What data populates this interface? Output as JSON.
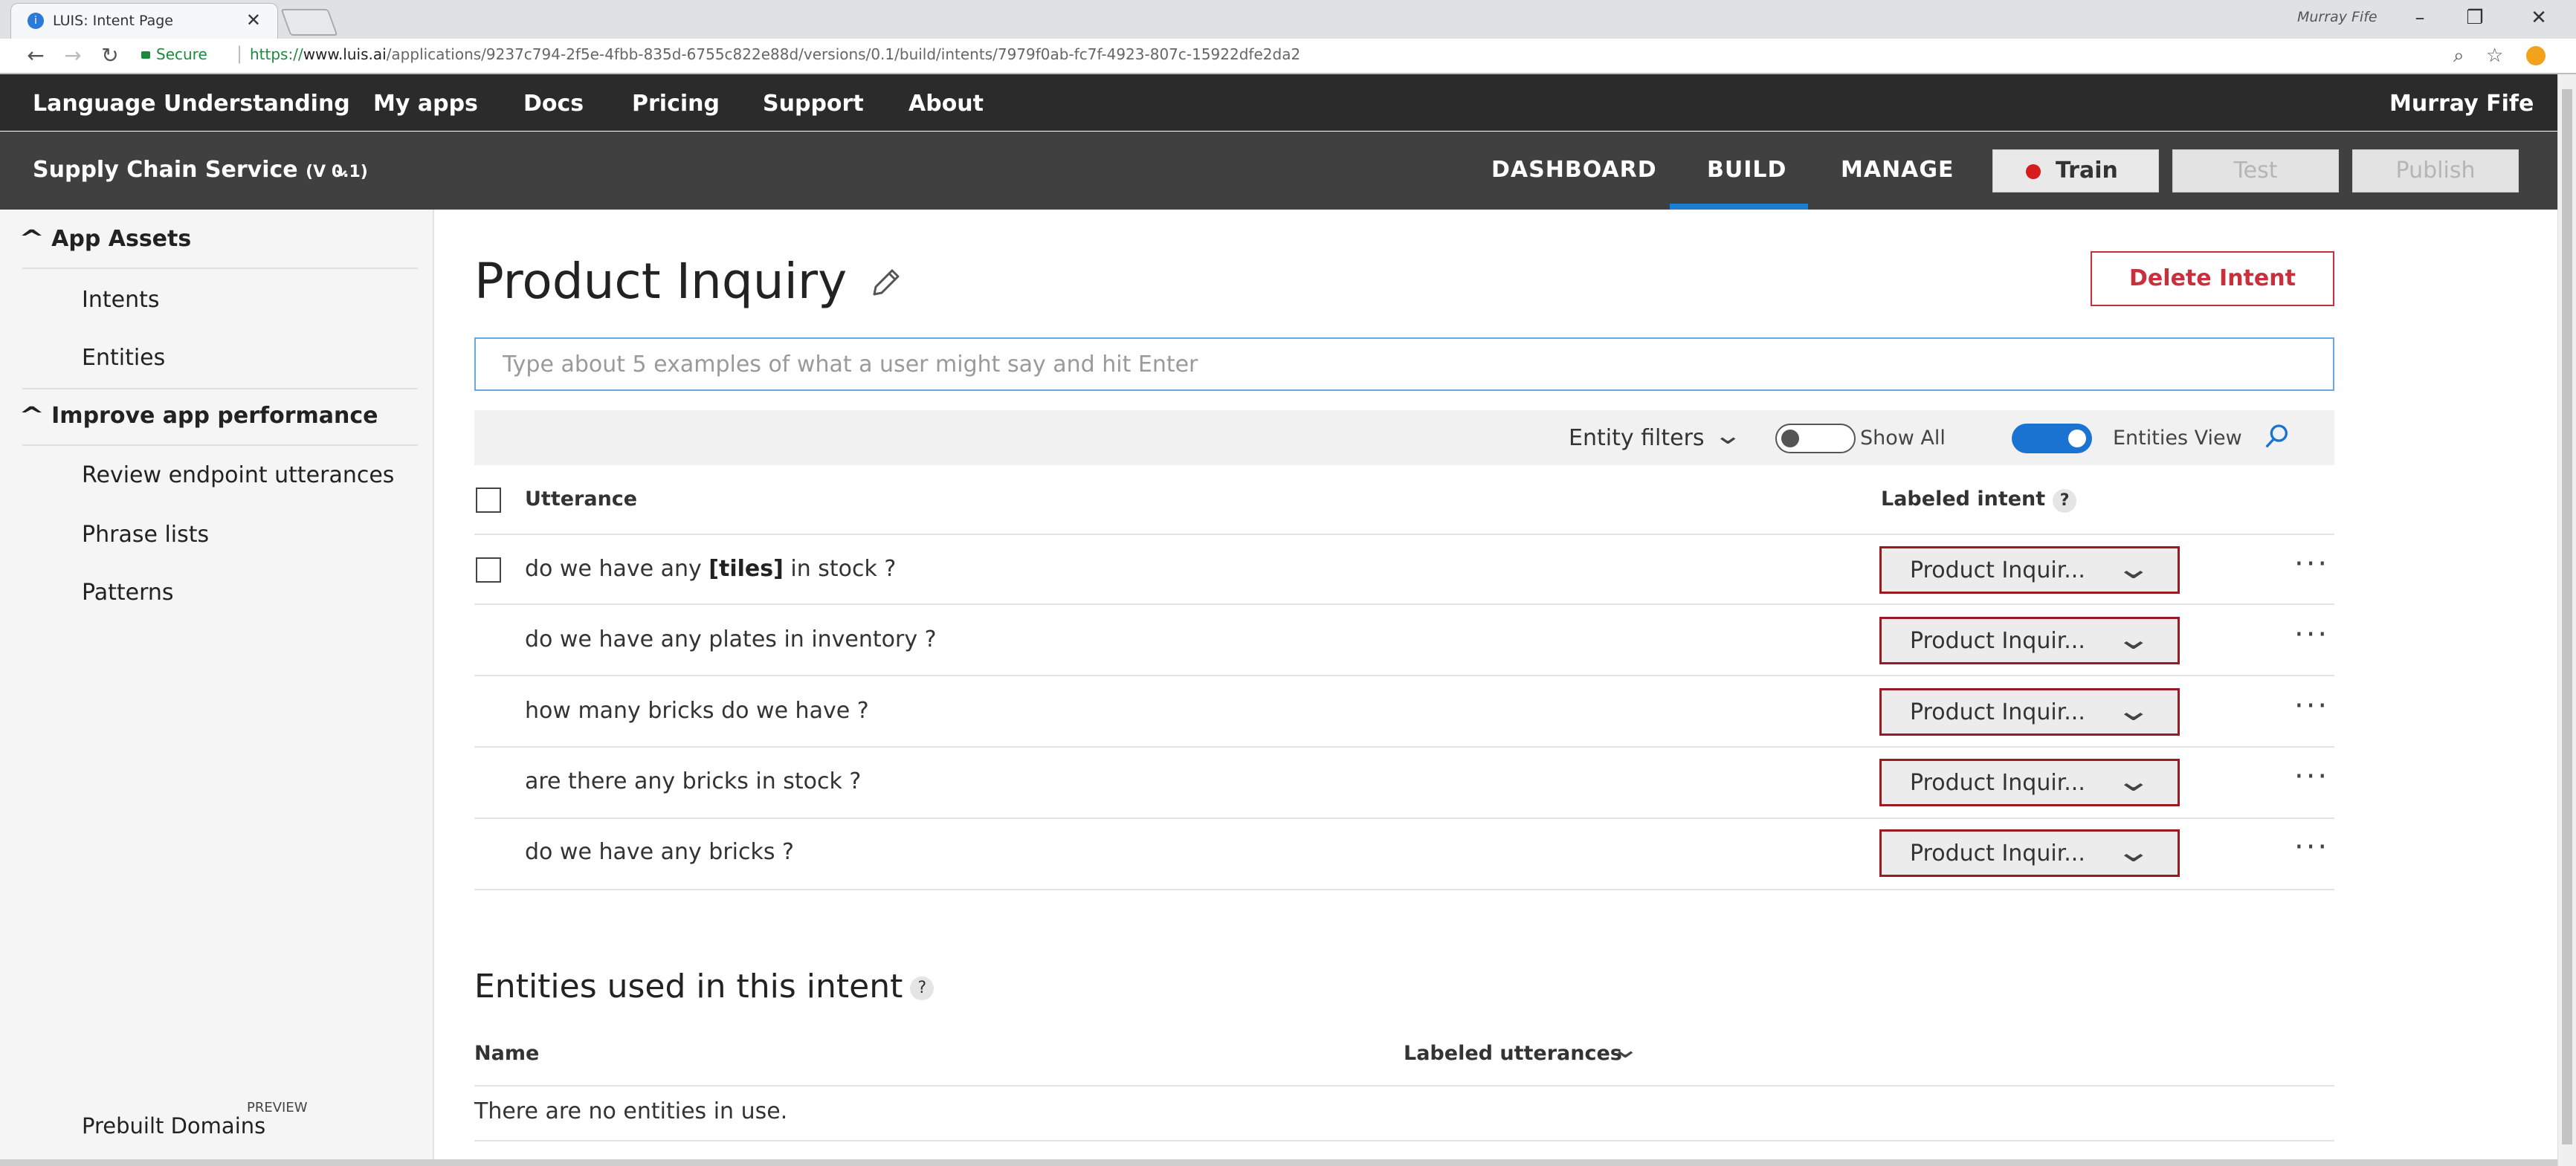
{
  "browser": {
    "tab_title": "LUIS: Intent Page",
    "tab_close": "✕",
    "window_user": "Murray Fife",
    "secure_label": "Secure",
    "url_scheme": "https://",
    "url_host": "www.luis.ai",
    "url_path": "/applications/9237c794-2f5e-4fbb-835d-6755c822e88d/versions/0.1/build/intents/7979f0ab-fc7f-4923-807c-15922dfe2da2"
  },
  "topnav": {
    "brand": "Language Understanding",
    "items": [
      "My apps",
      "Docs",
      "Pricing",
      "Support",
      "About"
    ],
    "user": "Murray Fife"
  },
  "subnav": {
    "app_name": "Supply Chain Service",
    "app_version": "(V 0.1)",
    "tabs": [
      "DASHBOARD",
      "BUILD",
      "MANAGE"
    ],
    "active_tab": "BUILD",
    "train_label": "Train",
    "test_label": "Test",
    "publish_label": "Publish"
  },
  "sidebar": {
    "section1": "App Assets",
    "section1_items": [
      "Intents",
      "Entities"
    ],
    "section2": "Improve app performance",
    "section2_items": [
      "Review endpoint utterances",
      "Phrase lists",
      "Patterns"
    ],
    "prebuilt": "Prebuilt Domains",
    "preview": "PREVIEW"
  },
  "main": {
    "title": "Product Inquiry",
    "delete_label": "Delete Intent",
    "input_placeholder": "Type about 5 examples of what a user might say and hit Enter",
    "entity_filters": "Entity filters",
    "show_all": "Show All",
    "show_all_on": false,
    "entities_view": "Entities View",
    "entities_view_on": true,
    "col_utterance": "Utterance",
    "col_intent": "Labeled intent",
    "help": "?",
    "rows": [
      {
        "pre": "do we have any ",
        "token": "[tiles]",
        "post": " in stock ?",
        "intent": "Product Inquir...",
        "more": "···"
      },
      {
        "pre": "do we have any plates in inventory ?",
        "token": "",
        "post": "",
        "intent": "Product Inquir...",
        "more": "···"
      },
      {
        "pre": "how many bricks do we have ?",
        "token": "",
        "post": "",
        "intent": "Product Inquir...",
        "more": "···"
      },
      {
        "pre": "are there any bricks in stock ?",
        "token": "",
        "post": "",
        "intent": "Product Inquir...",
        "more": "···"
      },
      {
        "pre": "do we have any bricks ?",
        "token": "",
        "post": "",
        "intent": "Product Inquir...",
        "more": "···"
      }
    ],
    "entities_title": "Entities used in this intent",
    "ent_col_name": "Name",
    "ent_col_labeled": "Labeled utterances",
    "no_entities": "There are no entities in use."
  },
  "colors": {
    "nav_bg": "#2b2b2b",
    "subnav_bg": "#404040",
    "accent": "#1a7fd0",
    "delete_red": "#c8303c",
    "dropdown_border": "#9a1a24",
    "train_dot": "#d61c1c"
  }
}
